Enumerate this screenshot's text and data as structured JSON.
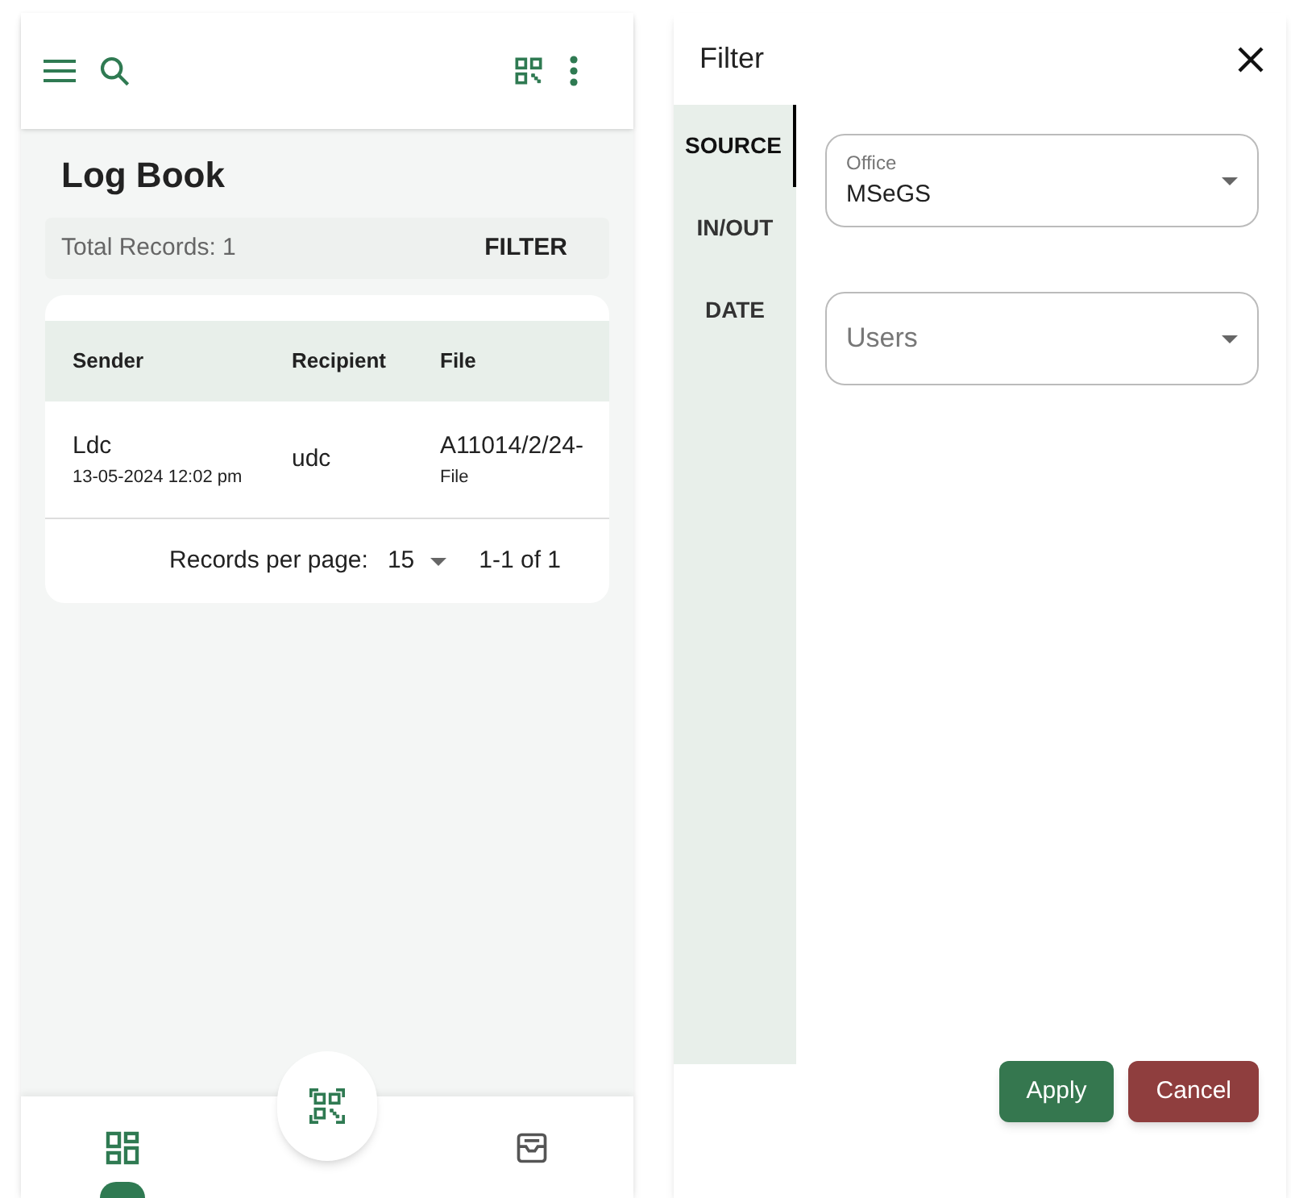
{
  "log_book": {
    "title": "Log Book",
    "total_records": "Total Records: 1",
    "filter_button": "FILTER",
    "table": {
      "columns": [
        "Sender",
        "Recipient",
        "File"
      ],
      "rows": [
        {
          "sender": "Ldc",
          "date": "13-05-2024 12:02 pm",
          "recipient": "udc",
          "file": "A11014/2/24-",
          "file_type": "File"
        }
      ]
    },
    "pagination": {
      "label": "Records per page:",
      "per_page": "15",
      "range": "1-1 of 1"
    }
  },
  "bottom_nav": [
    {
      "kind": "dashboard",
      "selected": true
    },
    {
      "kind": "scan",
      "selected": false
    },
    {
      "kind": "inbox",
      "selected": false
    }
  ],
  "filter_panel": {
    "title": "Filter",
    "tabs": [
      {
        "label": "SOURCE",
        "selected": true
      },
      {
        "label": "IN/OUT",
        "selected": false
      },
      {
        "label": "DATE",
        "selected": false
      }
    ],
    "fields": [
      {
        "label": "Office",
        "value": "MSeGS"
      },
      {
        "placeholder": "Users"
      }
    ],
    "buttons": [
      {
        "label": "Apply",
        "kind": "primary"
      },
      {
        "label": "Cancel",
        "kind": "danger"
      }
    ]
  }
}
